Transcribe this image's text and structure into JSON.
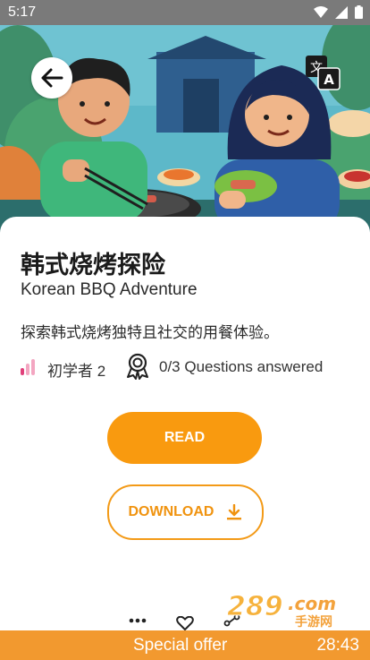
{
  "status_bar": {
    "time": "5:17"
  },
  "story": {
    "title_cn": "韩式烧烤探险",
    "title_en": "Korean BBQ Adventure",
    "description": "探索韩式烧烤独特且社交的用餐体验。",
    "level": "初学者 2",
    "questions": "0/3 Questions answered"
  },
  "actions": {
    "read_label": "READ",
    "download_label": "DOWNLOAD"
  },
  "offer": {
    "label": "Special offer",
    "timer": "28:43"
  },
  "icons": {
    "back": "arrow-left-icon",
    "translate": "translate-icon",
    "level": "signal-bars-icon",
    "award": "award-ribbon-icon",
    "download": "download-icon",
    "more": "more-dots-icon",
    "favorite": "heart-icon",
    "share": "share-icon"
  },
  "colors": {
    "accent": "#f99a0f",
    "offer_bar": "#f2992f",
    "level_bars": "#e0407a"
  }
}
